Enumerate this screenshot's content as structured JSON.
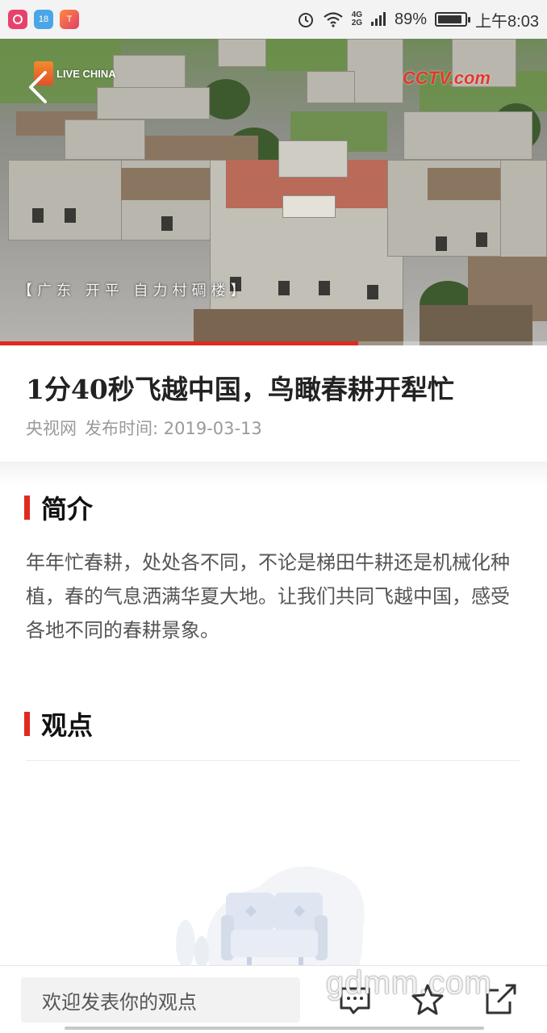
{
  "status_bar": {
    "apps": [
      "app-1",
      "18",
      "T"
    ],
    "network_top": "4G",
    "network_bottom": "2G",
    "battery": "89%",
    "battery_level": 0.89,
    "time": "上午8:03"
  },
  "video": {
    "logo_left": "LIVE CHINA",
    "logo_right": "CCTV.com",
    "caption": "【广东 开平 自力村碉楼】",
    "progress": 0.655,
    "progress_color": "#e02a1f"
  },
  "article": {
    "title": "1分40秒飞越中国，鸟瞰春耕开犁忙",
    "source": "央视网",
    "publish_label": "发布时间: 2019-03-13"
  },
  "intro": {
    "heading": "简介",
    "body": "年年忙春耕，处处各不同，不论是梯田牛耕还是机械化种植，春的气息洒满华夏大地。让我们共同飞越中国，感受各地不同的春耕景象。"
  },
  "opinions": {
    "heading": "观点"
  },
  "bottom_bar": {
    "comment_placeholder": "欢迎发表你的观点",
    "icons": [
      "comment-icon",
      "star-icon",
      "share-icon"
    ]
  },
  "watermark": "gdmm.com",
  "accent_color": "#e02a1f"
}
